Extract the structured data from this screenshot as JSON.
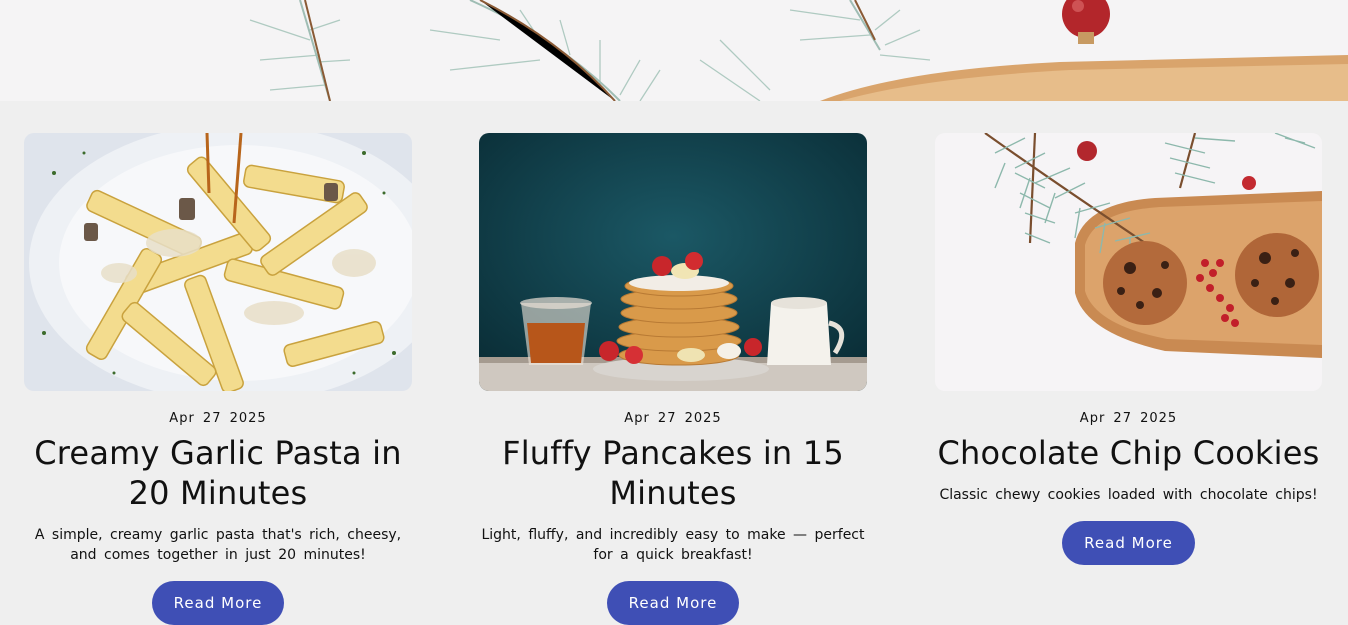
{
  "hero": {
    "image": "pine-branches-and-ornament-banner"
  },
  "posts": [
    {
      "image": "creamy-penne-pasta-photo",
      "date": "Apr 27 2025",
      "title": "Creamy Garlic Pasta in 20 Minutes",
      "description": "A simple, creamy garlic pasta that's rich, cheesy, and comes together in just 20 minutes!",
      "button": "Read More"
    },
    {
      "image": "pancake-stack-photo",
      "date": "Apr 27 2025",
      "title": "Fluffy Pancakes in 15 Minutes",
      "description": "Light, fluffy, and incredibly easy to make — perfect for a quick breakfast!",
      "button": "Read More"
    },
    {
      "image": "chocolate-chip-cookies-photo",
      "date": "Apr 27 2025",
      "title": "Chocolate Chip Cookies",
      "description": "Classic chewy cookies loaded with chocolate chips!",
      "button": "Read More"
    }
  ],
  "colors": {
    "accent": "#3f4fb5",
    "background": "#efefef"
  }
}
